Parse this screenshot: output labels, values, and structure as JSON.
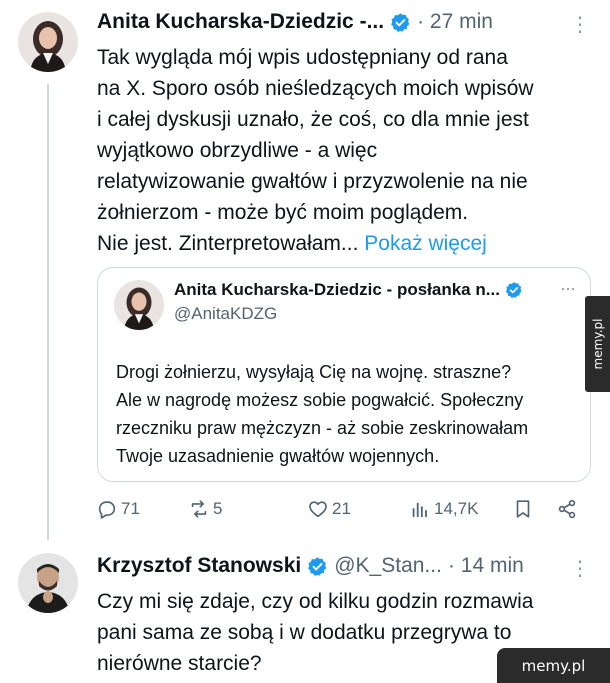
{
  "tweet1": {
    "author_name": "Anita Kucharska-Dziedzic -...",
    "time": "· 27 min",
    "more_menu": "⋮",
    "text_lines": [
      "Tak wygląda mój wpis udostępniany od rana",
      "na X. Sporo osób nieśledzących moich wpisów",
      "i całej dyskusji uznało, że coś, co dla mnie jest",
      "wyjątkowo obrzydliwe - a więc",
      "relatywizowanie gwałtów i przyzwolenie na nie",
      "żołnierzom - może być moim poglądem.",
      "Nie jest. Zinterpretowałam..."
    ],
    "show_more": "Pokaż więcej",
    "quote": {
      "author_name": "Anita Kucharska-Dziedzic - posłanka n...",
      "handle": "@AnitaKDZG",
      "more_menu": "···",
      "text_lines": [
        "Drogi żołnierzu, wysyłają Cię na wojnę. straszne?",
        "Ale w nagrodę możesz sobie pogwałcić. Społeczny",
        "rzeczniku praw mężczyzn - aż sobie zeskrinowałam",
        "Twoje uzasadnienie gwałtów wojennych."
      ]
    },
    "actions": {
      "replies": "71",
      "reposts": "5",
      "likes": "21",
      "views": "14,7K"
    }
  },
  "tweet2": {
    "author_name": "Krzysztof Stanowski",
    "handle": "@K_Stan...",
    "time": "· 14 min",
    "more_menu": "⋮",
    "text_lines": [
      "Czy mi się zdaje, czy od kilku godzin rozmawia",
      "pani sama ze sobą i w dodatku przegrywa to",
      "nierówne starcie?"
    ]
  },
  "watermark": {
    "side": "memy.pl",
    "corner": "memy.pl"
  },
  "colors": {
    "link": "#1d9bf0",
    "verified": "#1d9bf0",
    "muted": "#536471",
    "border": "#cfd9de"
  }
}
